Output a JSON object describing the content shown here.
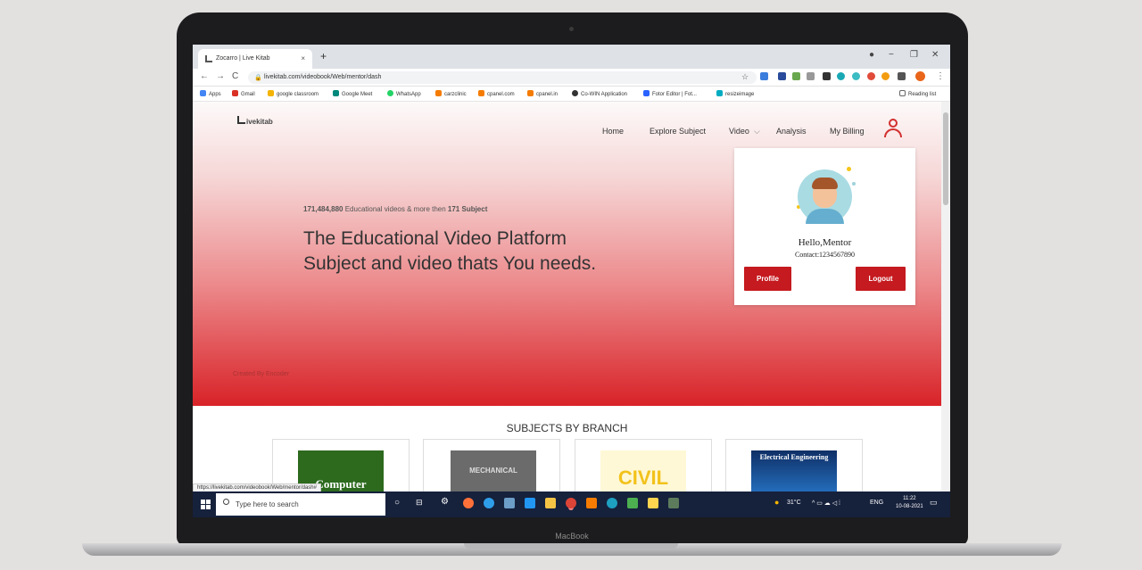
{
  "device": {
    "brand": "MacBook"
  },
  "browser": {
    "tab_title": "Zocarro | Live Kitab",
    "new_tab": "+",
    "tab_close": "×",
    "url": "livekitab.com/videobook/Web/mentor/dash",
    "window_controls": {
      "minimize": "−",
      "restore": "❐",
      "close": "✕"
    },
    "nav": {
      "back": "←",
      "forward": "→",
      "reload": "C"
    },
    "bookmarks": [
      "Apps",
      "Gmail",
      "google classroom",
      "Google Meet",
      "WhatsApp",
      "carzclinic",
      "cpanel.com",
      "cpanel.in",
      "Co-WIN Application",
      "Fotor Editor | Fot...",
      "resizeimage"
    ],
    "reading_list": "Reading list",
    "status_url": "https://livekitab.com/videobook/Web/mentor/dash#"
  },
  "site": {
    "logo_text": "ivekitab",
    "nav": [
      "Home",
      "Explore Subject",
      "Video",
      "Analysis",
      "My Billing"
    ],
    "video_chevron": "⌵",
    "hero": {
      "stats_videos": "171,484,880",
      "stats_middle": " Educational videos & more then ",
      "stats_subjects": "171 Subject",
      "title_line1": "The Educational Video Platform",
      "title_line2": "Subject and video thats You needs."
    },
    "credit": "Created By Encoder",
    "profile": {
      "greeting": "Hello,Mentor",
      "contact": "Contact:1234567890",
      "profile_button": "Profile",
      "logout_button": "Logout"
    },
    "subjects_heading": "SUBJECTS BY BRANCH",
    "subjects": [
      {
        "label": "Computer",
        "color": "#2d6a1e"
      },
      {
        "label": "MECHANICAL",
        "color": "#6b6b6b"
      },
      {
        "label": "CIVIL",
        "color": "#f2c21b"
      },
      {
        "label": "Electrical Engineering",
        "color": "#0f2f66"
      }
    ]
  },
  "taskbar": {
    "search_placeholder": "Type here to search",
    "weather": "31°C",
    "language": "ENG",
    "time": "11:22",
    "date": "10-08-2021"
  }
}
